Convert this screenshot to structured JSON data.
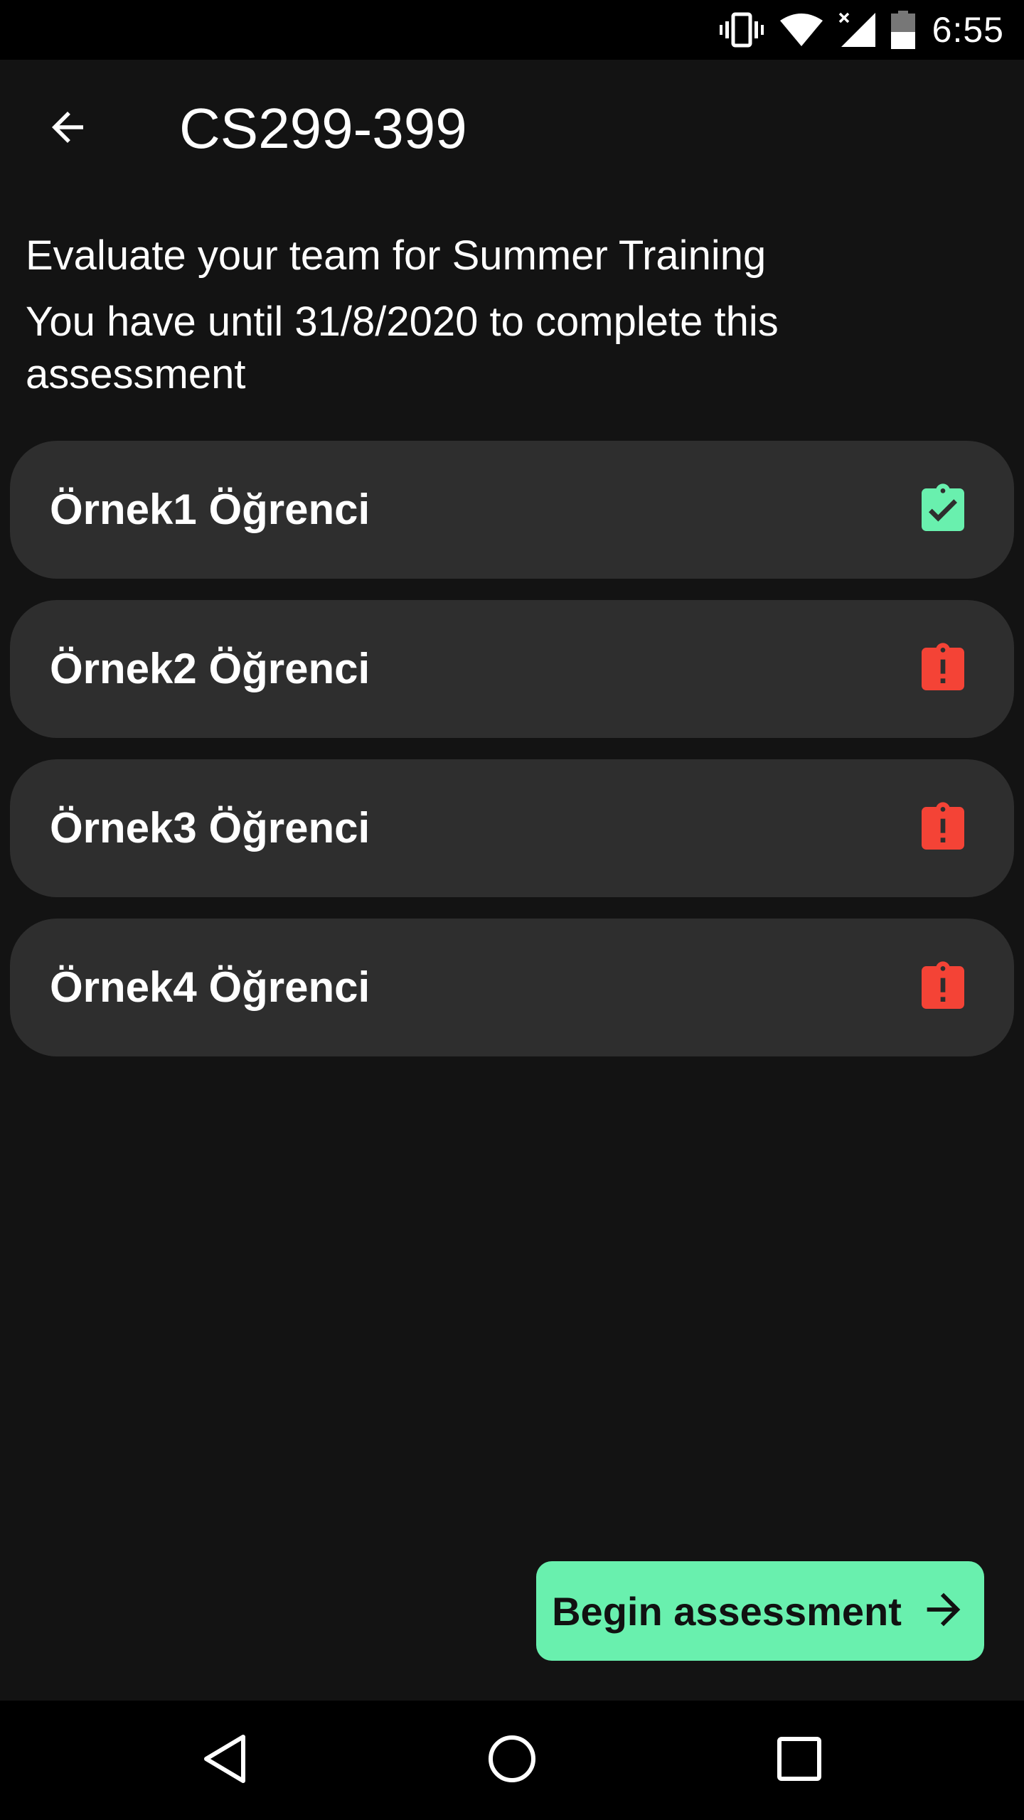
{
  "status_bar": {
    "time": "6:55",
    "icons": [
      "vibrate-icon",
      "wifi-icon",
      "cellular-no-signal-icon",
      "battery-icon"
    ]
  },
  "app_bar": {
    "title": "CS299-399",
    "back_icon": "arrow-back-icon"
  },
  "intro": {
    "title": "Evaluate your team for Summer Training",
    "deadline": "You have until 31/8/2020 to complete this assessment"
  },
  "members": [
    {
      "name": "Örnek1 Öğrenci",
      "status": "completed",
      "icon": "clipboard-check-icon",
      "color": "#69f0ae"
    },
    {
      "name": "Örnek2 Öğrenci",
      "status": "pending",
      "icon": "clipboard-alert-icon",
      "color": "#f44336"
    },
    {
      "name": "Örnek3 Öğrenci",
      "status": "pending",
      "icon": "clipboard-alert-icon",
      "color": "#f44336"
    },
    {
      "name": "Örnek4 Öğrenci",
      "status": "pending",
      "icon": "clipboard-alert-icon",
      "color": "#f44336"
    }
  ],
  "primary_action": {
    "label": "Begin assessment",
    "icon": "arrow-forward-icon",
    "color": "#69f0ae"
  },
  "nav_bar": {
    "icons": [
      "nav-back-icon",
      "nav-home-icon",
      "nav-recents-icon"
    ]
  },
  "colors": {
    "background": "#131313",
    "card": "#2e2e2e",
    "accent": "#69f0ae",
    "alert": "#f44336"
  }
}
